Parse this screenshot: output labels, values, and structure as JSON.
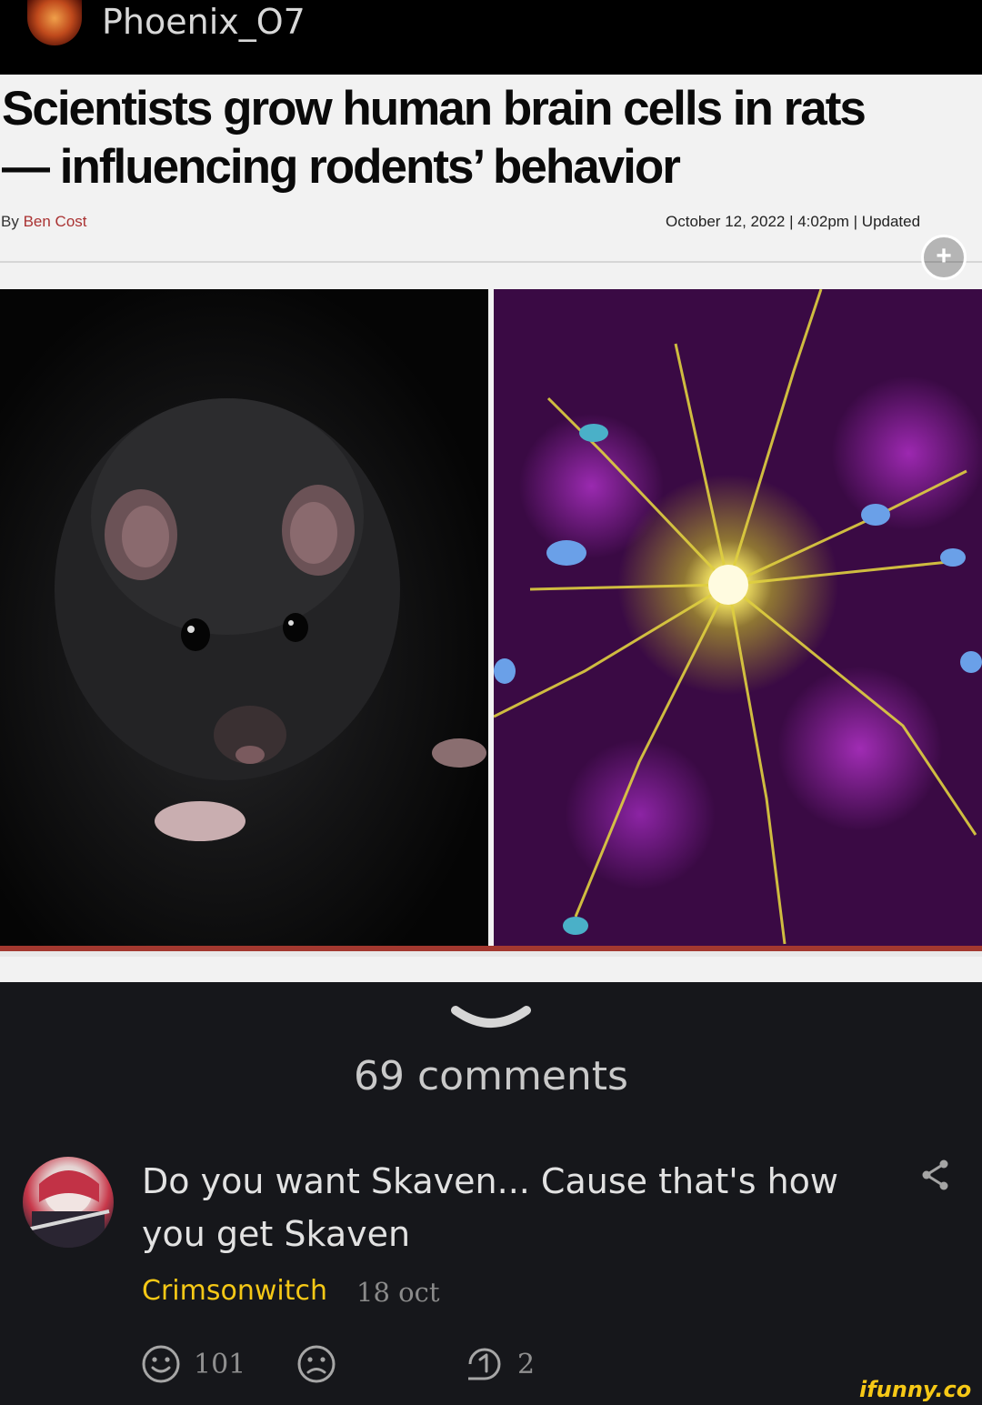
{
  "poster": {
    "username": "Phoenix_O7"
  },
  "article": {
    "headline_line1": "Scientists grow human brain cells in rats",
    "headline_line2": "— influencing rodents’ behavior",
    "byline_prefix": "By",
    "author": "Ben Cost",
    "dateline": "October 12, 2022 | 4:02pm | Updated",
    "expand_symbol": "+"
  },
  "comments": {
    "count_label": "69 comments",
    "items": [
      {
        "text": "Do you want Skaven... Cause that's how you get Skaven",
        "author": "Crimsonwitch",
        "time": "18 oct",
        "smile_count": "101",
        "reply_count": "2"
      }
    ]
  },
  "watermark": "ifunny.co",
  "colors": {
    "accent": "#f5c816",
    "background": "#16171b",
    "article_rule": "#a3382f"
  },
  "icons": [
    "expand-icon",
    "collapse-chevron-icon",
    "share-icon",
    "smile-icon",
    "frown-icon",
    "reply-icon"
  ]
}
